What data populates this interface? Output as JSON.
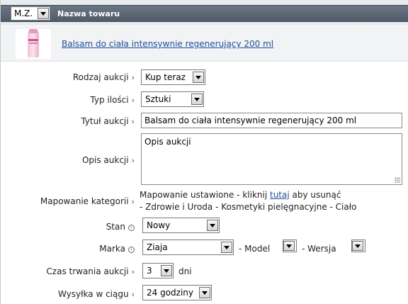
{
  "header": {
    "mz_select_value": "M.Z.",
    "column_title": "Nazwa towaru"
  },
  "product": {
    "name": "Balsam do ciała intensywnie regenerujący 200 ml"
  },
  "form": {
    "auction_type": {
      "label": "Rodzaj aukcji",
      "value": "Kup teraz"
    },
    "quantity_type": {
      "label": "Typ ilości",
      "value": "Sztuki"
    },
    "auction_title": {
      "label": "Tytuł aukcji",
      "value": "Balsam do ciała intensywnie regenerujący 200 ml"
    },
    "description": {
      "label": "Opis aukcji",
      "value": "Opis aukcji"
    },
    "category_mapping": {
      "label": "Mapowanie kategorii",
      "text_before": "Mapowanie ustawione - kliknij",
      "link": "tutaj",
      "text_after": "aby usunąć",
      "path": "- Zdrowie i Uroda - Kosmetyki pielęgnacyjne - Ciało"
    },
    "condition": {
      "label": "Stan",
      "value": "Nowy"
    },
    "brand": {
      "label": "Marka",
      "value": "Ziaja",
      "model_label": "- Model",
      "model_value": "",
      "version_label": "- Wersja",
      "version_value": ""
    },
    "duration": {
      "label": "Czas trwania aukcji",
      "value": "3",
      "unit": "dni"
    },
    "shipping": {
      "label": "Wysyłka w ciągu",
      "value": "24 godziny"
    }
  }
}
